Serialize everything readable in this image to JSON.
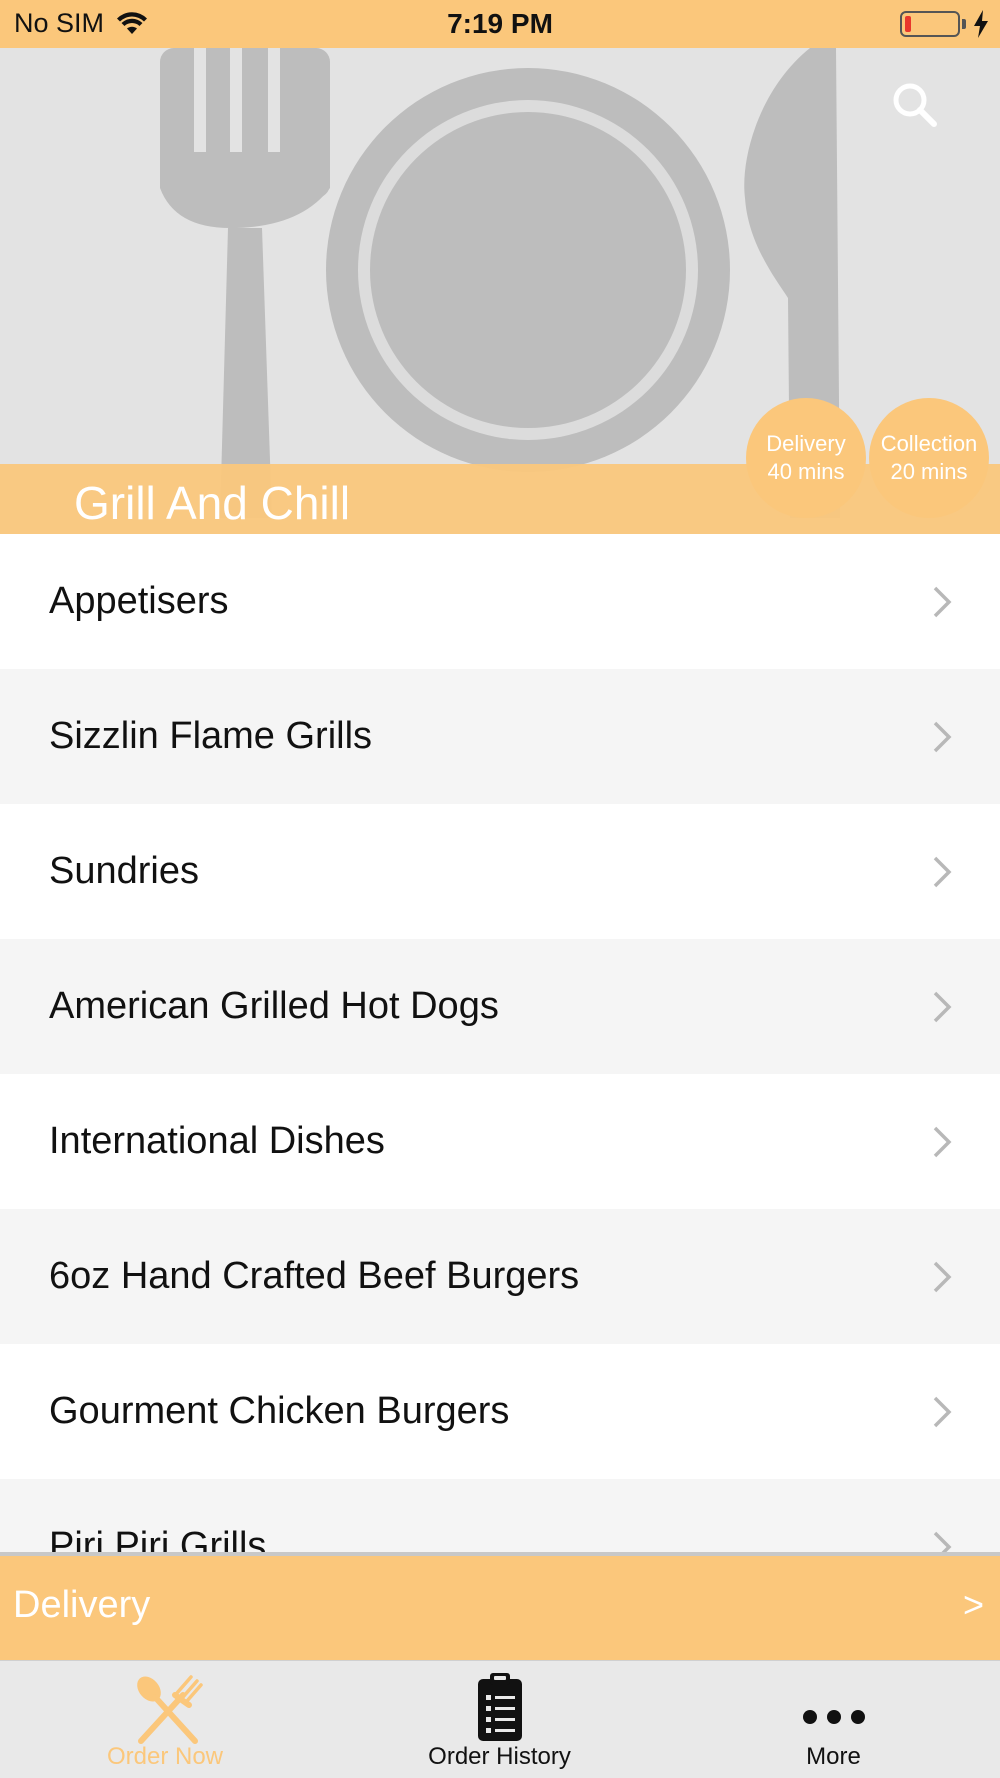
{
  "status_bar": {
    "carrier": "No SIM",
    "time": "7:19 PM",
    "battery_level_percent": 12
  },
  "hero": {
    "restaurant_name": "Grill And Chill",
    "search_icon": "search-icon",
    "badges": {
      "delivery": {
        "label": "Delivery",
        "time": "40 mins"
      },
      "collection": {
        "label": "Collection",
        "time": "20 mins"
      }
    }
  },
  "categories": [
    {
      "label": "Appetisers"
    },
    {
      "label": "Sizzlin Flame Grills"
    },
    {
      "label": "Sundries"
    },
    {
      "label": "American Grilled Hot Dogs"
    },
    {
      "label": "International Dishes"
    },
    {
      "label": "6oz Hand Crafted Beef Burgers"
    },
    {
      "label": "Gourment Chicken Burgers"
    },
    {
      "label": "Piri Piri Grills"
    }
  ],
  "delivery_bar": {
    "label": "Delivery",
    "arrow": ">"
  },
  "tab_bar": {
    "tabs": [
      {
        "label": "Order Now",
        "icon": "utensils-icon",
        "active": true
      },
      {
        "label": "Order History",
        "icon": "clipboard-icon",
        "active": false
      },
      {
        "label": "More",
        "icon": "more-icon",
        "active": false
      }
    ]
  },
  "colors": {
    "accent": "#fbc77b",
    "hero_bg": "#e3e3e3",
    "hero_art": "#bdbdbd",
    "row_alt": "#f5f5f5",
    "battery_low": "#e8372c"
  }
}
